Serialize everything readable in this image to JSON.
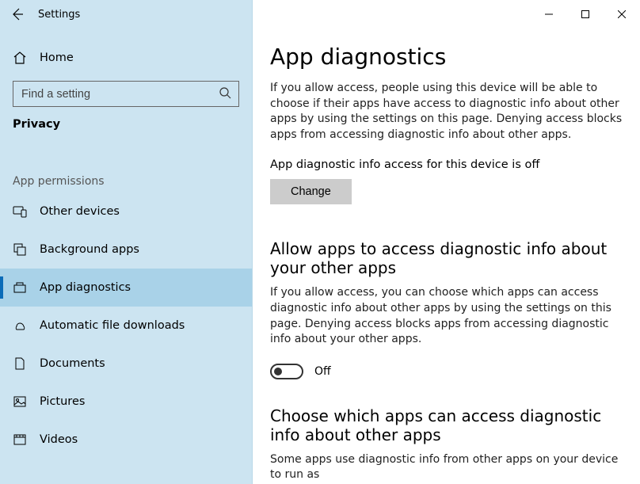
{
  "window": {
    "title": "Settings"
  },
  "sidebar": {
    "home_label": "Home",
    "search_placeholder": "Find a setting",
    "category": "Privacy",
    "section_label": "App permissions",
    "items": [
      {
        "id": "other-devices",
        "label": "Other devices",
        "active": false
      },
      {
        "id": "background-apps",
        "label": "Background apps",
        "active": false
      },
      {
        "id": "app-diagnostics",
        "label": "App diagnostics",
        "active": true
      },
      {
        "id": "automatic-file-downloads",
        "label": "Automatic file downloads",
        "active": false
      },
      {
        "id": "documents",
        "label": "Documents",
        "active": false
      },
      {
        "id": "pictures",
        "label": "Pictures",
        "active": false
      },
      {
        "id": "videos",
        "label": "Videos",
        "active": false
      }
    ]
  },
  "main": {
    "heading": "App diagnostics",
    "intro": "If you allow access, people using this device will be able to choose if their apps have access to diagnostic info about other apps by using the settings on this page. Denying access blocks apps from accessing diagnostic info about other apps.",
    "status_line": "App diagnostic info access for this device is off",
    "change_label": "Change",
    "section2_heading": "Allow apps to access diagnostic info about your other apps",
    "section2_para": "If you allow access, you can choose which apps can access diagnostic info about other apps by using the settings on this page. Denying access blocks apps from accessing diagnostic info about your other apps.",
    "toggle_state": "Off",
    "section3_heading": "Choose which apps can access diagnostic info about other apps",
    "section3_para": "Some apps use diagnostic info from other apps on your device to run as"
  }
}
